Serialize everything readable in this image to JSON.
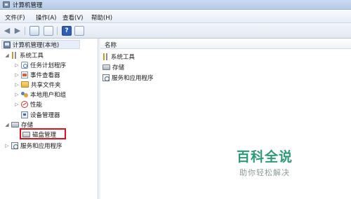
{
  "window": {
    "title": "计算机管理"
  },
  "menu": [
    "文件(F)",
    "操作(A)",
    "查看(V)",
    "帮助(H)"
  ],
  "toolbar": {
    "back_icon": "back-arrow-icon",
    "forward_icon": "forward-arrow-icon",
    "help_label": "?"
  },
  "tree": {
    "root": "计算机管理(本地)",
    "system_tools": "系统工具",
    "task_scheduler": "任务计划程序",
    "event_viewer": "事件查看器",
    "shared_folders": "共享文件夹",
    "local_users": "本地用户和组",
    "performance": "性能",
    "device_manager": "设备管理器",
    "storage": "存储",
    "disk_management": "磁盘管理",
    "services": "服务和应用程序"
  },
  "list": {
    "column": "名称",
    "items": [
      "系统工具",
      "存储",
      "服务和应用程序"
    ]
  },
  "watermark": {
    "title": "百科全说",
    "subtitle": "助你轻松解决"
  },
  "colors": {
    "highlight": "#e0101c",
    "watermark": "#2e9a78"
  }
}
